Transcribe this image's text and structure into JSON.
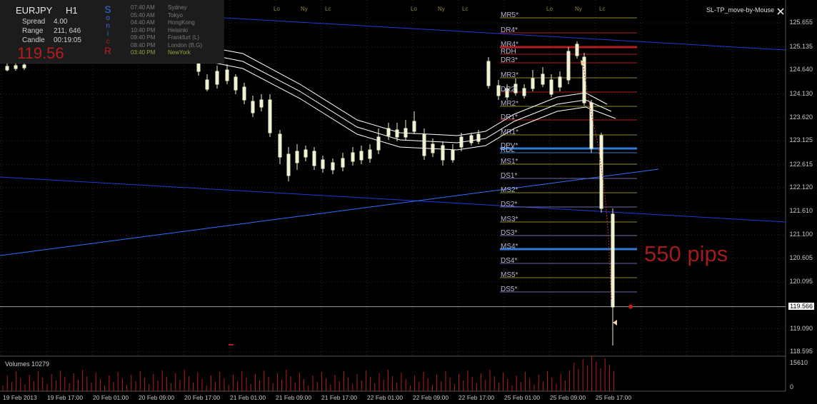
{
  "window": {
    "title": "SL-TP_move-by-Mouse",
    "close_icon": "close-icon"
  },
  "symbol": {
    "name": "EURJPY",
    "timeframe": "H1"
  },
  "info": {
    "spread_label": "Spread",
    "spread_value": "4.00",
    "range_label": "Range",
    "range_value": "211, 646",
    "candle_label": "Candle",
    "candle_value": "00:19:05",
    "bid_price": "119.56",
    "brand_letters": [
      "S",
      "o",
      "n",
      "i",
      "c",
      "R"
    ]
  },
  "sessions": [
    {
      "time": "07:40 AM",
      "name": "Sydney",
      "color": "#7a7a7a"
    },
    {
      "time": "05:40 AM",
      "name": "Tokyo",
      "color": "#7a7a7a"
    },
    {
      "time": "04:40 AM",
      "name": "HongKong",
      "color": "#7a7a7a"
    },
    {
      "time": "10:40 PM",
      "name": "Helsinki",
      "color": "#7a7a7a"
    },
    {
      "time": "09:40 PM",
      "name": "Frankfurt  (L)",
      "color": "#7a7a7a"
    },
    {
      "time": "08:40 PM",
      "name": "London  (B,G)",
      "color": "#7a7a7a"
    },
    {
      "time": "03:40 PM",
      "name": "NewYork",
      "color": "#9aa23a"
    }
  ],
  "session_marks": [
    "Lo",
    "Ny",
    "Lc"
  ],
  "price_axis": [
    "125.655",
    "125.135",
    "124.640",
    "124.130",
    "123.620",
    "123.125",
    "122.615",
    "122.120",
    "121.610",
    "121.100",
    "120.605",
    "120.095",
    "119.566",
    "119.090",
    "118.595"
  ],
  "current_price": "119.566",
  "volumes": {
    "label": "Volumes 10279",
    "axis_top": "15610",
    "axis_bottom": "0"
  },
  "time_axis": [
    "19 Feb 2013",
    "19 Feb 17:00",
    "20 Feb 01:00",
    "20 Feb 09:00",
    "20 Feb 17:00",
    "21 Feb 01:00",
    "21 Feb 09:00",
    "21 Feb 17:00",
    "22 Feb 01:00",
    "22 Feb 09:00",
    "22 Feb 17:00",
    "25 Feb 01:00",
    "25 Feb 09:00",
    "25 Feb 17:00"
  ],
  "levels": [
    {
      "label": "MR5*"
    },
    {
      "label": "DR4*"
    },
    {
      "label": "MR4*"
    },
    {
      "label": "RDH"
    },
    {
      "label": "DR3*"
    },
    {
      "label": "MR3*"
    },
    {
      "label": "DR2*"
    },
    {
      "label": "MR2*"
    },
    {
      "label": "DR1*"
    },
    {
      "label": "MR1*"
    },
    {
      "label": "DPV*"
    },
    {
      "label": "RDL"
    },
    {
      "label": "MS1*"
    },
    {
      "label": "DS1*"
    },
    {
      "label": "MS2*"
    },
    {
      "label": "DS2*"
    },
    {
      "label": "MS3*"
    },
    {
      "label": "DS3*"
    },
    {
      "label": "MS4*"
    },
    {
      "label": "DS4*"
    },
    {
      "label": "MS5*"
    },
    {
      "label": "DS5*"
    }
  ],
  "annotation": "550 pips",
  "colors": {
    "candle": "#f0f0d2",
    "trendline": "#1f3ad6",
    "trendline2": "#2a70ff",
    "envelope": "#ffffff",
    "grid": "#2a2a2a",
    "resistance": "#b41e1e",
    "pivot": "#2f7bd6",
    "price_text": "#b41e1e"
  }
}
